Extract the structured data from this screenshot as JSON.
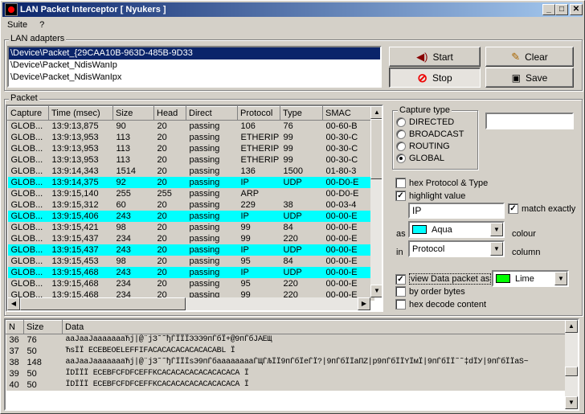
{
  "window": {
    "title": "LAN Packet Interceptor  [ Nyukers ]",
    "btn_min": "_",
    "btn_max": "□",
    "btn_close": "✕"
  },
  "menu": [
    {
      "label": "Suite"
    },
    {
      "label": "?"
    }
  ],
  "adapters": {
    "label": "LAN adapters",
    "items": [
      "\\Device\\Packet_{29CAA10B-963D-485B-9D33",
      "\\Device\\Packet_NdisWanIp",
      "\\Device\\Packet_NdisWanIpx"
    ]
  },
  "buttons": {
    "start": "Start",
    "stop": "Stop",
    "clear": "Clear",
    "save": "Save"
  },
  "packet": {
    "label": "Packet",
    "columns": [
      "Capture",
      "Time (msec)",
      "Size",
      "Head",
      "Direct",
      "Protocol",
      "Type",
      "SMAC"
    ],
    "rows": [
      {
        "cells": [
          "GLOB...",
          "13:9:13,875",
          "90",
          "20",
          "passing",
          "106",
          "76",
          "00-60-B"
        ],
        "hl": false
      },
      {
        "cells": [
          "GLOB...",
          "13:9:13,953",
          "113",
          "20",
          "passing",
          "ETHERIP",
          "99",
          "00-30-C"
        ],
        "hl": false
      },
      {
        "cells": [
          "GLOB...",
          "13:9:13,953",
          "113",
          "20",
          "passing",
          "ETHERIP",
          "99",
          "00-30-C"
        ],
        "hl": false
      },
      {
        "cells": [
          "GLOB...",
          "13:9:13,953",
          "113",
          "20",
          "passing",
          "ETHERIP",
          "99",
          "00-30-C"
        ],
        "hl": false
      },
      {
        "cells": [
          "GLOB...",
          "13:9:14,343",
          "1514",
          "20",
          "passing",
          "136",
          "1500",
          "01-80-3"
        ],
        "hl": false
      },
      {
        "cells": [
          "GLOB...",
          "13:9:14,375",
          "92",
          "20",
          "passing",
          "IP",
          "UDP",
          "00-D0-E"
        ],
        "hl": true
      },
      {
        "cells": [
          "GLOB...",
          "13:9:15,140",
          "255",
          "255",
          "passing",
          "ARP",
          "",
          "00-D0-E"
        ],
        "hl": false
      },
      {
        "cells": [
          "GLOB...",
          "13:9:15,312",
          "60",
          "20",
          "passing",
          "229",
          "38",
          "00-03-4"
        ],
        "hl": false
      },
      {
        "cells": [
          "GLOB...",
          "13:9:15,406",
          "243",
          "20",
          "passing",
          "IP",
          "UDP",
          "00-00-E"
        ],
        "hl": true
      },
      {
        "cells": [
          "GLOB...",
          "13:9:15,421",
          "98",
          "20",
          "passing",
          "99",
          "84",
          "00-00-E"
        ],
        "hl": false
      },
      {
        "cells": [
          "GLOB...",
          "13:9:15,437",
          "234",
          "20",
          "passing",
          "99",
          "220",
          "00-00-E"
        ],
        "hl": false
      },
      {
        "cells": [
          "GLOB...",
          "13:9:15,437",
          "243",
          "20",
          "passing",
          "IP",
          "UDP",
          "00-00-E"
        ],
        "hl": true
      },
      {
        "cells": [
          "GLOB...",
          "13:9:15,453",
          "98",
          "20",
          "passing",
          "95",
          "84",
          "00-00-E"
        ],
        "hl": false
      },
      {
        "cells": [
          "GLOB...",
          "13:9:15,468",
          "243",
          "20",
          "passing",
          "IP",
          "UDP",
          "00-00-E"
        ],
        "hl": true
      },
      {
        "cells": [
          "GLOB...",
          "13:9:15,468",
          "234",
          "20",
          "passing",
          "95",
          "220",
          "00-00-E"
        ],
        "hl": false
      },
      {
        "cells": [
          "GLOB...",
          "13:9:15,468",
          "234",
          "20",
          "passing",
          "99",
          "220",
          "00-00-E"
        ],
        "hl": false
      }
    ]
  },
  "capture_type": {
    "label": "Capture type",
    "options": [
      "DIRECTED",
      "BROADCAST",
      "ROUTING",
      "GLOBAL"
    ],
    "selected": "GLOBAL",
    "filter_value": ""
  },
  "options": {
    "hex_protocol": "hex Protocol & Type",
    "highlight": "highlight value",
    "highlight_value": "IP",
    "match_exactly": "match exactly",
    "as_label": "as",
    "colour_value": "Aqua",
    "colour_hex": "#00ffff",
    "colour_label": "colour",
    "in_label": "in",
    "column_value": "Protocol",
    "column_label": "column",
    "view_data": "view Data packet as",
    "view_colour": "Lime",
    "view_colour_hex": "#00ff00",
    "order_bytes": "by order bytes",
    "hex_decode": "hex decode content"
  },
  "data": {
    "columns": [
      "N",
      "Size",
      "Data"
    ],
    "rows": [
      [
        "36",
        "76",
        "ааЈааЈаааааааЋј|@¨јЗ˜˜ђЃЇЇЇЭЭЭ9пЃбЇ+@9пЃбЈАЕЩ"
      ],
      [
        "37",
        "50",
        "ЋsЇЇ ECEBEOELEFFIFACACACACACACACABL Ї"
      ],
      [
        "38",
        "148",
        "ааЈааЈаааааааЋј|@¨јЗ˜˜ђЃЇЇЇsЭ9пЃбааааааааЃЩЃЉЇЇ9пЃбЇеЃЇ?|9пЃбЇЇаПZ|р9пЃбЇЇYЇмЇ|9пЃбЇЇ˜˜‡dЇУ|9пЃбЇЇаS~"
      ],
      [
        "39",
        "50",
        "ЇDЇЇЇ ECEBFCFDFCEFFKCACACACACACACACACA Ї"
      ],
      [
        "40",
        "50",
        "ЇDЇЇЇ ECEBFCFDFCEFFKCACACACACACACACACA Ї"
      ]
    ]
  }
}
